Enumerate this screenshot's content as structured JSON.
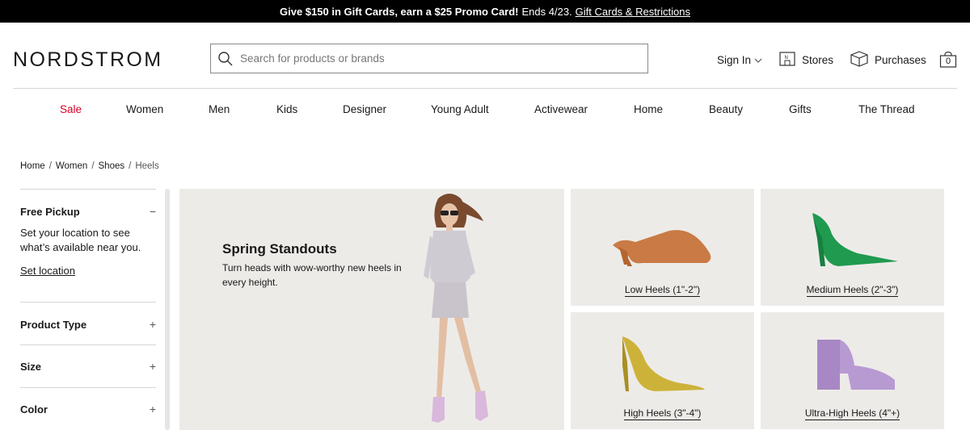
{
  "promo": {
    "headline": "Give $150 in Gift Cards, earn a $25 Promo Card!",
    "ends": "Ends 4/23.",
    "link": "Gift Cards & Restrictions"
  },
  "header": {
    "logo": "NORDSTROM",
    "search_placeholder": "Search for products or brands",
    "sign_in": "Sign In",
    "stores": "Stores",
    "purchases": "Purchases",
    "bag_count": "0"
  },
  "nav": [
    "Sale",
    "Women",
    "Men",
    "Kids",
    "Designer",
    "Young Adult",
    "Activewear",
    "Home",
    "Beauty",
    "Gifts",
    "The Thread"
  ],
  "breadcrumb": [
    "Home",
    "Women",
    "Shoes",
    "Heels"
  ],
  "sidebar": {
    "free_pickup": {
      "title": "Free Pickup",
      "text": "Set your location to see what’s available near you.",
      "link": "Set location"
    },
    "filters": [
      "Product Type",
      "Size",
      "Color"
    ]
  },
  "hero": {
    "title": "Spring Standouts",
    "subtitle": "Turn heads with wow-worthy new heels in every height."
  },
  "tiles": [
    {
      "label": "Low Heels (1\"-2\")"
    },
    {
      "label": "Medium Heels (2\"-3\")"
    },
    {
      "label": "High Heels (3\"-4\")"
    },
    {
      "label": "Ultra-High Heels (4\"+)"
    }
  ],
  "colors": {
    "sale": "#d6002a",
    "tile_bg": "#edebe8",
    "banner_bg": "#000000"
  }
}
